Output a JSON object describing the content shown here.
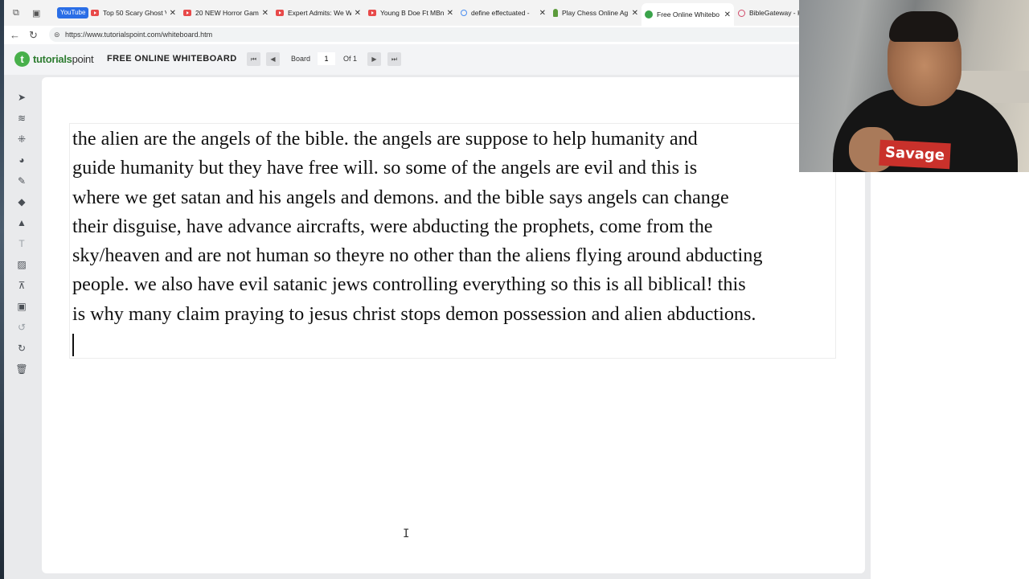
{
  "browser": {
    "tabs": [
      {
        "title": "YouTube",
        "kind": "badge"
      },
      {
        "title": "Top 50 Scary Ghost V",
        "icon": "youtube-icon"
      },
      {
        "title": "20 NEW Horror Gam",
        "icon": "youtube-icon"
      },
      {
        "title": "Expert Admits: We W",
        "icon": "youtube-icon"
      },
      {
        "title": "Young B Doe Ft MBn",
        "icon": "youtube-icon"
      },
      {
        "title": "define effectuated -",
        "icon": "search-icon"
      },
      {
        "title": "Play Chess Online Ag",
        "icon": "chess-pawn-icon"
      },
      {
        "title": "Free Online Whitebo",
        "icon": "tutorialspoint-icon",
        "active": true
      },
      {
        "title": "BibleGateway - Ke",
        "icon": "biblegateway-icon"
      }
    ],
    "close_glyph": "✕",
    "url": "https://www.tutorialspoint.com/whiteboard.htm"
  },
  "app": {
    "logo_letter": "t",
    "logo_brand": "tutorials",
    "logo_brand2": "point",
    "title": "FREE ONLINE WHITEBOARD",
    "board_label": "Board",
    "board_value": "1",
    "of_label": "Of 1"
  },
  "tools": [
    "select-arrow-icon",
    "layers-icon",
    "grid-icon",
    "color-palette-icon",
    "pencil-icon",
    "eraser-icon",
    "shapes-icon",
    "text-icon",
    "image-icon",
    "presentation-icon",
    "save-board-icon",
    "undo-icon",
    "redo-icon",
    "trash-icon"
  ],
  "board": {
    "text": "the alien are the angels of the bible. the angels are suppose to help humanity and\nguide humanity but they have free will. so some of the angels are evil and this is\nwhere we get satan and his angels and demons. and the bible says angels can change\ntheir disguise, have advance aircrafts, were abducting the prophets, come from the\nsky/heaven and are not human so theyre no other than the aliens flying around abducting\npeople. we also have evil satanic jews controlling everything so this is all biblical! this\nis why many claim praying to jesus christ stops demon possession and alien abductions."
  },
  "webcam": {
    "shirt_text": "Savage"
  }
}
